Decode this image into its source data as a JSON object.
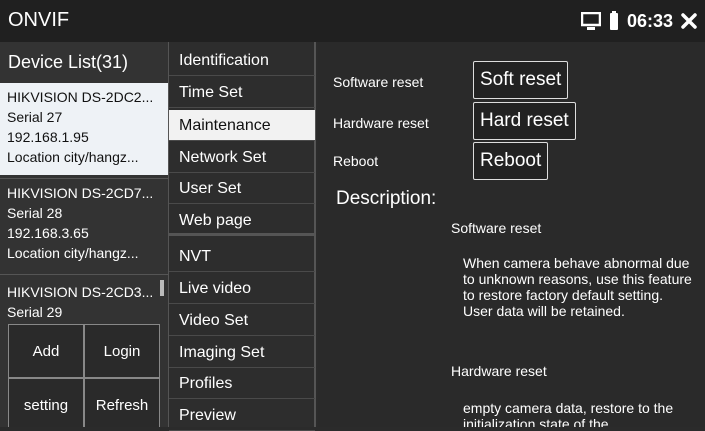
{
  "titlebar": {
    "title": "ONVIF",
    "clock": "06:33",
    "icons": [
      "monitor-icon",
      "battery-icon",
      "close-icon"
    ]
  },
  "device_list": {
    "title": "Device List(31)",
    "devices": [
      {
        "name": "HIKVISION DS-2DC2...",
        "serial": "Serial  27",
        "ip": "192.168.1.95",
        "location": "Location  city/hangz..."
      },
      {
        "name": "HIKVISION DS-2CD7...",
        "serial": "Serial  28",
        "ip": "192.168.3.65",
        "location": "Location  city/hangz..."
      },
      {
        "name": "HIKVISION DS-2CD3...",
        "serial": "Serial  29"
      }
    ],
    "buttons": {
      "add": "Add",
      "login": "Login",
      "setting": "setting",
      "refresh": "Refresh"
    }
  },
  "menu": {
    "items": [
      "Identification",
      "Time Set",
      "Maintenance",
      "Network Set",
      "User Set",
      "Web page",
      "NVT",
      "Live video",
      "Video Set",
      "Imaging Set",
      "Profiles",
      "Preview"
    ],
    "selected": "Maintenance"
  },
  "maintenance": {
    "rows": [
      {
        "label": "Software reset",
        "button": "Soft reset"
      },
      {
        "label": "Hardware reset",
        "button": "Hard reset"
      },
      {
        "label": "Reboot",
        "button": "Reboot"
      }
    ],
    "description_title": "Description:",
    "software_heading": "Software reset",
    "software_text": "When camera behave abnormal due to unknown reasons, use this feature to restore factory default setting. User data will be retained.",
    "hardware_heading": "Hardware reset",
    "hardware_text": "empty camera data, restore to the initialization state of the"
  }
}
